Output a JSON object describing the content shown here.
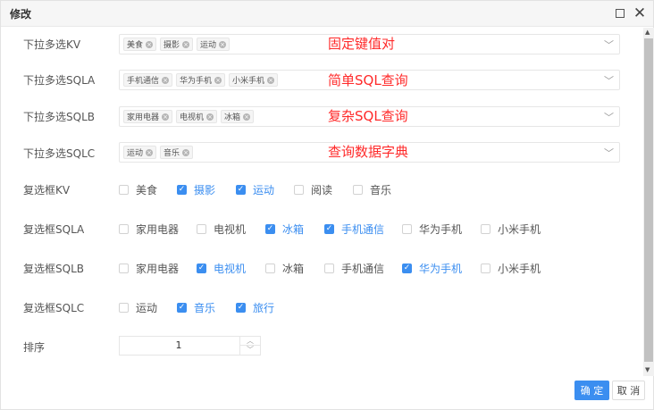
{
  "dialog": {
    "title": "修改"
  },
  "dropdowns": [
    {
      "label": "下拉多选KV",
      "tags": [
        "美食",
        "摄影",
        "运动"
      ],
      "note": "固定键值对"
    },
    {
      "label": "下拉多选SQLA",
      "tags": [
        "手机通信",
        "华为手机",
        "小米手机"
      ],
      "note": "简单SQL查询"
    },
    {
      "label": "下拉多选SQLB",
      "tags": [
        "家用电器",
        "电视机",
        "冰箱"
      ],
      "note": "复杂SQL查询"
    },
    {
      "label": "下拉多选SQLC",
      "tags": [
        "运动",
        "音乐"
      ],
      "note": "查询数据字典"
    }
  ],
  "checkgroups": [
    {
      "label": "复选框KV",
      "options": [
        {
          "text": "美食",
          "checked": false
        },
        {
          "text": "摄影",
          "checked": true
        },
        {
          "text": "运动",
          "checked": true
        },
        {
          "text": "阅读",
          "checked": false
        },
        {
          "text": "音乐",
          "checked": false
        }
      ]
    },
    {
      "label": "复选框SQLA",
      "options": [
        {
          "text": "家用电器",
          "checked": false
        },
        {
          "text": "电视机",
          "checked": false
        },
        {
          "text": "冰箱",
          "checked": true
        },
        {
          "text": "手机通信",
          "checked": true
        },
        {
          "text": "华为手机",
          "checked": false
        },
        {
          "text": "小米手机",
          "checked": false
        }
      ]
    },
    {
      "label": "复选框SQLB",
      "options": [
        {
          "text": "家用电器",
          "checked": false
        },
        {
          "text": "电视机",
          "checked": true
        },
        {
          "text": "冰箱",
          "checked": false
        },
        {
          "text": "手机通信",
          "checked": false
        },
        {
          "text": "华为手机",
          "checked": true
        },
        {
          "text": "小米手机",
          "checked": false
        }
      ]
    },
    {
      "label": "复选框SQLC",
      "options": [
        {
          "text": "运动",
          "checked": false
        },
        {
          "text": "音乐",
          "checked": true
        },
        {
          "text": "旅行",
          "checked": true
        }
      ]
    }
  ],
  "sort": {
    "label": "排序",
    "value": "1"
  },
  "buttons": {
    "ok": "确 定",
    "cancel": "取 消"
  },
  "colors": {
    "accent": "#3b8ef0",
    "annotation": "#ff2a2a"
  },
  "icons": {
    "maximize": "maximize-icon",
    "close": "close-icon",
    "dropdown": "chevron-down-icon",
    "tag_remove": "tag-remove-icon"
  }
}
